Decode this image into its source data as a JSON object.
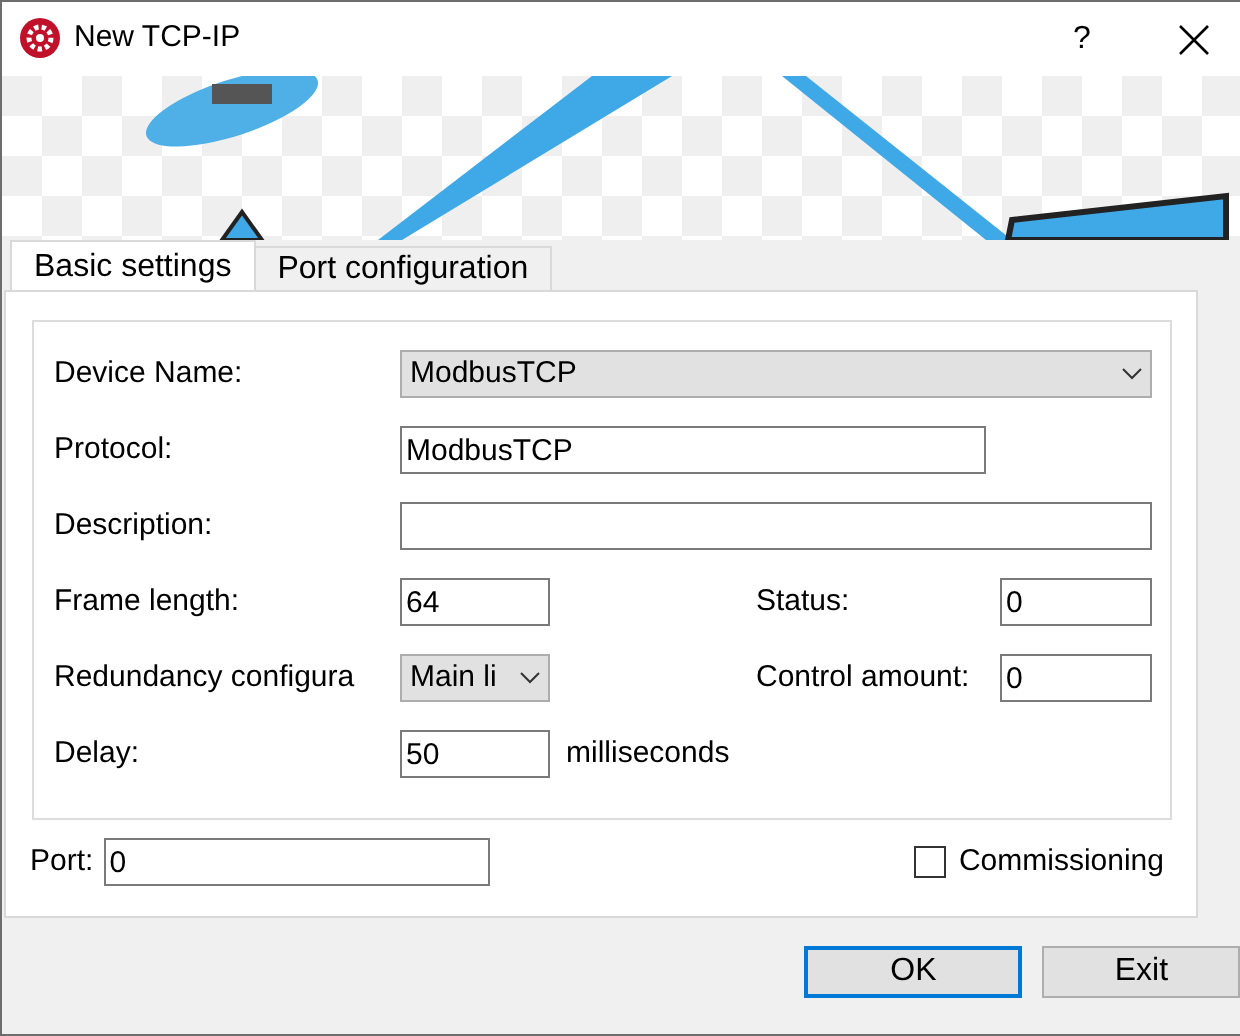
{
  "window": {
    "title": "New TCP-IP",
    "help": "?"
  },
  "tabs": [
    {
      "label": "Basic settings",
      "selected": true
    },
    {
      "label": "Port configuration",
      "selected": false
    }
  ],
  "rows": [
    {
      "fields": [
        {
          "kind": "select",
          "label": "Device Name:",
          "value": "ModbusTCP"
        }
      ]
    },
    {
      "fields": [
        {
          "kind": "input",
          "label": "Protocol:",
          "value": "ModbusTCP"
        }
      ]
    },
    {
      "fields": [
        {
          "kind": "input",
          "label": "Description:"
        }
      ]
    },
    {
      "fields": [
        {
          "kind": "input",
          "label": "Frame length:",
          "value": "64"
        },
        {
          "kind": "input",
          "label": "Status:",
          "value": "0"
        }
      ]
    },
    {
      "fields": [
        {
          "kind": "select",
          "label": "Redundancy configura",
          "value": "Main li"
        },
        {
          "kind": "input",
          "label": "Control amount:",
          "value": "0"
        }
      ]
    },
    {
      "fields": [
        {
          "kind": "input",
          "label": "Delay:",
          "value": "50",
          "unit": "milliseconds"
        }
      ]
    }
  ],
  "port": {
    "label": "Port:",
    "value": "0"
  },
  "commissioning": {
    "label": "Commissioning",
    "checked": false
  },
  "buttons": [
    {
      "label": "OK",
      "default": true
    },
    {
      "label": "Exit",
      "default": false
    }
  ]
}
